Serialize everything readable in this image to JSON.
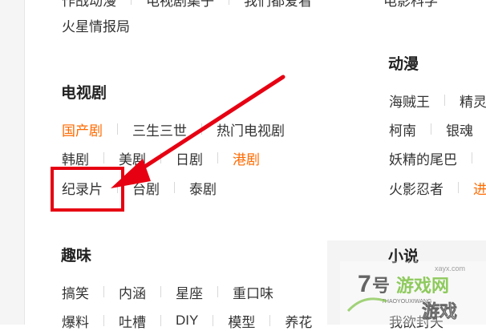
{
  "top_cut_row": [
    "作战动漫",
    "电视剧集子",
    "我们都爱看",
    "电影科学"
  ],
  "top_extra": "火星情报局",
  "tv": {
    "heading": "电视剧",
    "row1": [
      {
        "label": "国产剧",
        "highlight": true
      },
      {
        "label": "三生三世"
      },
      {
        "label": "热门电视剧"
      }
    ],
    "row2": [
      {
        "label": "韩剧"
      },
      {
        "label": "美剧"
      },
      {
        "label": "日剧"
      },
      {
        "label": "港剧",
        "highlight": true
      }
    ],
    "row3": [
      {
        "label": "纪录片"
      },
      {
        "label": "台剧"
      },
      {
        "label": "泰剧"
      }
    ]
  },
  "anime": {
    "heading": "动漫",
    "row1": [
      "海贼王",
      "精灵"
    ],
    "row2": [
      "柯南",
      "银魂"
    ],
    "row3": [
      "妖精的尾巴"
    ],
    "row4": [
      "火影忍者",
      "进"
    ]
  },
  "fun": {
    "heading": "趣味",
    "row1": [
      "搞笑",
      "内涵",
      "星座",
      "重口味"
    ],
    "row2": [
      "爆料",
      "吐槽",
      "DIY",
      "模型",
      "养花"
    ]
  },
  "novel": {
    "heading": "小说",
    "row1": [
      "我欲封天"
    ]
  },
  "watermark": {
    "number": "7号",
    "brand": "游戏网",
    "site": "7HAOYOUXIWANG",
    "sub": "游戏",
    "domain": "xayx.com"
  },
  "annotation": {
    "arrow_color": "#e60012",
    "highlight_color": "#ff6a00"
  }
}
